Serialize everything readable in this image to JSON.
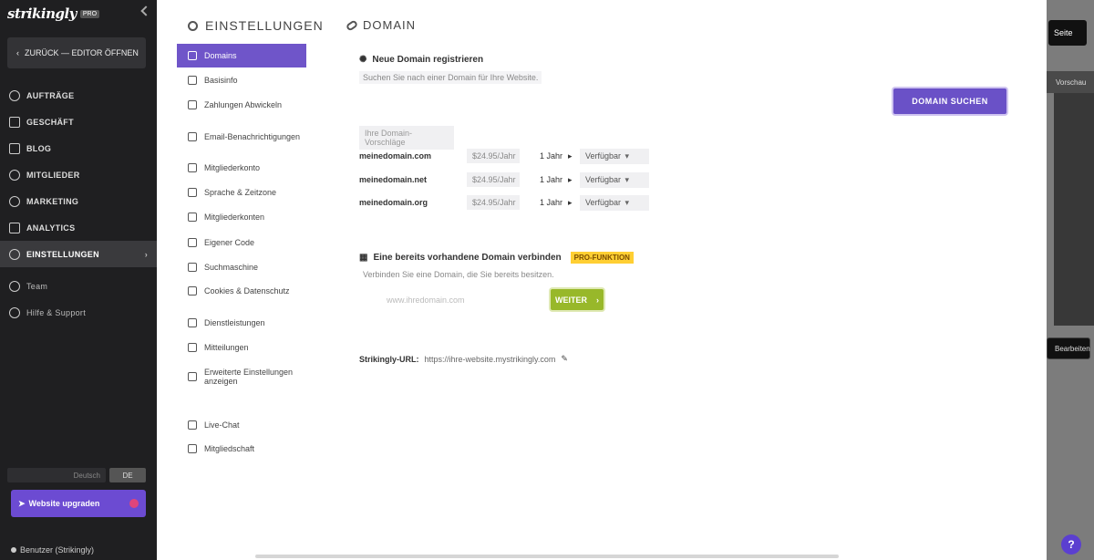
{
  "sidebar": {
    "brand": "strikingly",
    "brand_badge": "PRO",
    "back_label": "ZURÜCK — EDITOR ÖFFNEN",
    "items": [
      {
        "label": "AUFTRÄGE"
      },
      {
        "label": "GESCHÄFT"
      },
      {
        "label": "BLOG"
      },
      {
        "label": "MITGLIEDER"
      },
      {
        "label": "MARKETING"
      },
      {
        "label": "ANALYTICS"
      },
      {
        "label": "EINSTELLUNGEN"
      }
    ],
    "extra": [
      {
        "label": "Team"
      },
      {
        "label": "Hilfe & Support"
      }
    ],
    "lang_value": "Deutsch",
    "lang_toggle": "DE",
    "upgrade_label": "Website upgraden",
    "user_label": "Benutzer (Strikingly)"
  },
  "subnav": {
    "title": "EINSTELLUNGEN",
    "items": [
      {
        "label": "Domains"
      },
      {
        "label": "Basisinfo"
      },
      {
        "label": "Zahlungen Abwickeln"
      },
      {
        "label": "Email-Benachrichtigungen"
      },
      {
        "label": "Mitgliederkonto"
      },
      {
        "label": "Sprache & Zeitzone"
      },
      {
        "label": "Mitgliederkonten"
      },
      {
        "label": "Eigener Code"
      },
      {
        "label": "Suchmaschine"
      },
      {
        "label": "Cookies & Datenschutz"
      },
      {
        "label": "Dienstleistungen"
      },
      {
        "label": "Mitteilungen"
      },
      {
        "label": "Erweiterte Einstellungen anzeigen"
      },
      {
        "label": "Live-Chat"
      },
      {
        "label": "Mitgliedschaft"
      }
    ]
  },
  "main": {
    "title": "DOMAIN",
    "register": {
      "heading": "Neue Domain registrieren",
      "hint": "Suchen Sie nach einer Domain für Ihre Website.",
      "button": "DOMAIN SUCHEN"
    },
    "table_label": "Ihre Domain-Vorschläge",
    "domains": [
      {
        "domain": "meinedomain.com",
        "price": "$24.95/Jahr",
        "period": "1 Jahr",
        "status": "Verfügbar"
      },
      {
        "domain": "meinedomain.net",
        "price": "$24.95/Jahr",
        "period": "1 Jahr",
        "status": "Verfügbar"
      },
      {
        "domain": "meinedomain.org",
        "price": "$24.95/Jahr",
        "period": "1 Jahr",
        "status": "Verfügbar"
      }
    ],
    "connect": {
      "heading": "Eine bereits vorhandene Domain verbinden",
      "badge": "PRO-FUNKTION",
      "hint": "Verbinden Sie eine Domain, die Sie bereits besitzen.",
      "placeholder": "www.ihredomain.com",
      "button": "WEITER"
    },
    "url": {
      "label": "Strikingly-URL:",
      "value": "https://ihre-website.mystrikingly.com"
    }
  },
  "right_strip": {
    "btn1": "Seite",
    "bar": "Vorschau",
    "btn2": "Bearbeiten",
    "help": "?"
  }
}
